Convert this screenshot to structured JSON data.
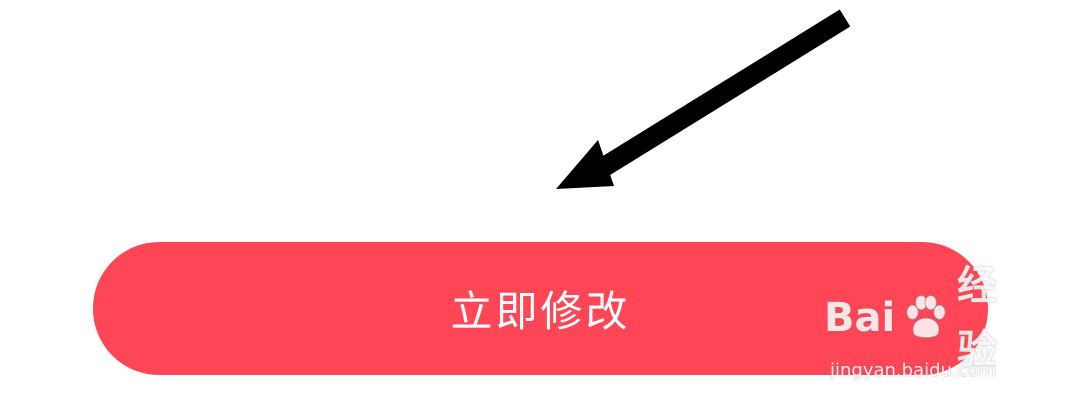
{
  "button": {
    "label": "立即修改",
    "color": "#ff4656",
    "text_color": "#ffffff"
  },
  "annotation": {
    "icon": "arrow-pointing-down-left-icon",
    "color": "#000000"
  },
  "watermark": {
    "brand_left": "Bai",
    "brand_right": "经验",
    "url": "jingyan.baidu.com",
    "icon": "paw-icon"
  }
}
